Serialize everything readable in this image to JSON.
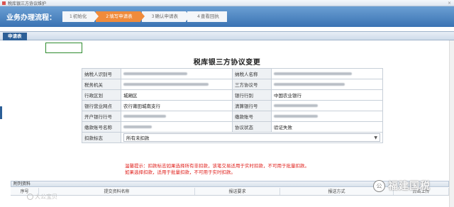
{
  "window": {
    "title": "税库银三方协议维护",
    "close": "×"
  },
  "flow": {
    "title": "业务办理流程：",
    "steps": [
      {
        "num": "1",
        "label": "初始化",
        "active": false
      },
      {
        "num": "2",
        "label": "填写申请表",
        "active": true
      },
      {
        "num": "3",
        "label": "确认申请表",
        "active": false
      },
      {
        "num": "4",
        "label": "查看回执",
        "active": false
      }
    ]
  },
  "section": {
    "tab": "申请表"
  },
  "form": {
    "title": "税库银三方协议变更",
    "rows": [
      {
        "l1": "纳税人识别号",
        "v1": "",
        "l2": "纳税人名称",
        "v2": ""
      },
      {
        "l1": "税务机关",
        "v1": "",
        "l2": "三方协议号",
        "v2": ""
      },
      {
        "l1": "行政区划",
        "v1": "城厢区",
        "l2": "银行行别",
        "v2": "中国农业银行"
      },
      {
        "l1": "银行营业网点",
        "v1": "农行莆田城南支行",
        "l2": "清算银行号",
        "v2": ""
      },
      {
        "l1": "开户银行行号",
        "v1": "",
        "l2": "缴款账号",
        "v2": ""
      },
      {
        "l1": "缴款账号名称",
        "v1": "",
        "l2": "协议状态",
        "v2": "验证失败"
      }
    ],
    "deduct": {
      "label": "扣款标志",
      "value": "所有未扣款"
    }
  },
  "tip": {
    "line1": "温馨提示：扣款标志如果选择所有非扣款，该笔交易适用于实时扣款，不可用于批量扣款。",
    "line2": "如果选择扣款，适用于批量扣款，不可用于实时扣款。"
  },
  "attachments": {
    "title": "附列资料",
    "headers": [
      "序号",
      "提交资料名称",
      "报送要求",
      "报送方式",
      "点击上传"
    ]
  },
  "watermarks": {
    "left": "大公宝贝",
    "right": "福建国税",
    "badge": "公"
  }
}
